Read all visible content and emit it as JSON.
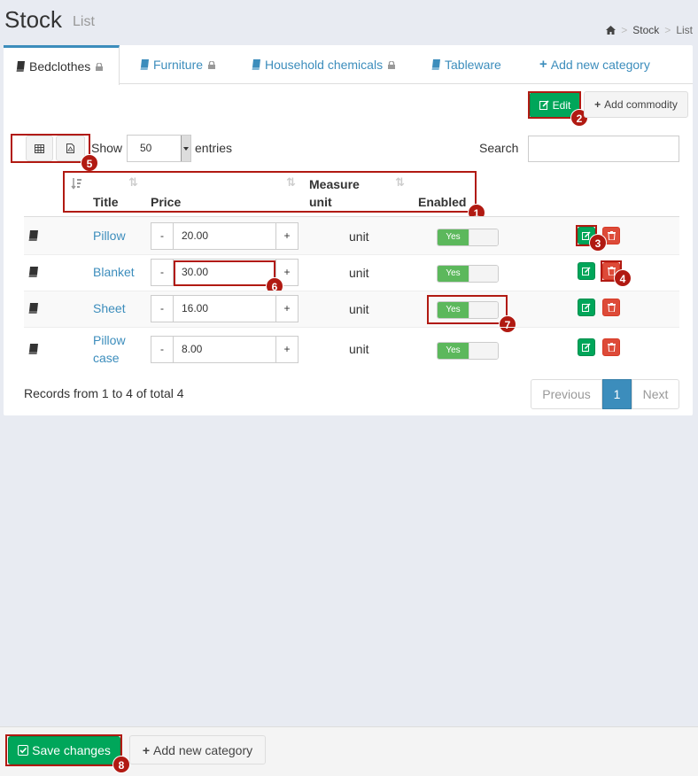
{
  "page": {
    "title": "Stock",
    "subtitle": "List"
  },
  "breadcrumb": {
    "items": [
      "Stock",
      "List"
    ]
  },
  "tabs": [
    {
      "label": "Bedclothes",
      "locked": true,
      "active": true
    },
    {
      "label": "Furniture",
      "locked": true,
      "active": false
    },
    {
      "label": "Household chemicals",
      "locked": true,
      "active": false
    },
    {
      "label": "Tableware",
      "locked": false,
      "active": false
    },
    {
      "label": "Add new category",
      "locked": false,
      "active": false
    }
  ],
  "toolbar": {
    "edit_label": "Edit",
    "add_commodity_label": "Add commodity"
  },
  "table_controls": {
    "show_label": "Show",
    "entries_value": "50",
    "entries_label": "entries",
    "search_label": "Search",
    "search_value": ""
  },
  "columns": {
    "title": "Title",
    "price": "Price",
    "measure_line1": "Measure",
    "measure_line2": "unit",
    "enabled": "Enabled"
  },
  "rows": [
    {
      "title": "Pillow",
      "price": "20.00",
      "unit": "unit",
      "enabled": "Yes"
    },
    {
      "title": "Blanket",
      "price": "30.00",
      "unit": "unit",
      "enabled": "Yes"
    },
    {
      "title": "Sheet",
      "price": "16.00",
      "unit": "unit",
      "enabled": "Yes"
    },
    {
      "title_line1": "Pillow",
      "title_line2": "case",
      "price": "8.00",
      "unit": "unit",
      "enabled": "Yes"
    }
  ],
  "stepper": {
    "minus": "-",
    "plus": "+"
  },
  "records_info": "Records from 1 to 4 of total 4",
  "pagination": {
    "previous": "Previous",
    "current": "1",
    "next": "Next"
  },
  "footer": {
    "save_label": "Save changes",
    "add_category_label": "Add new category"
  },
  "callouts": [
    "1",
    "2",
    "3",
    "4",
    "5",
    "6",
    "7",
    "8"
  ],
  "colors": {
    "primary": "#3c8dbc",
    "success": "#00a65a",
    "danger": "#dd4b39",
    "toggle_on": "#5cb85c",
    "callout": "#b11a12"
  }
}
